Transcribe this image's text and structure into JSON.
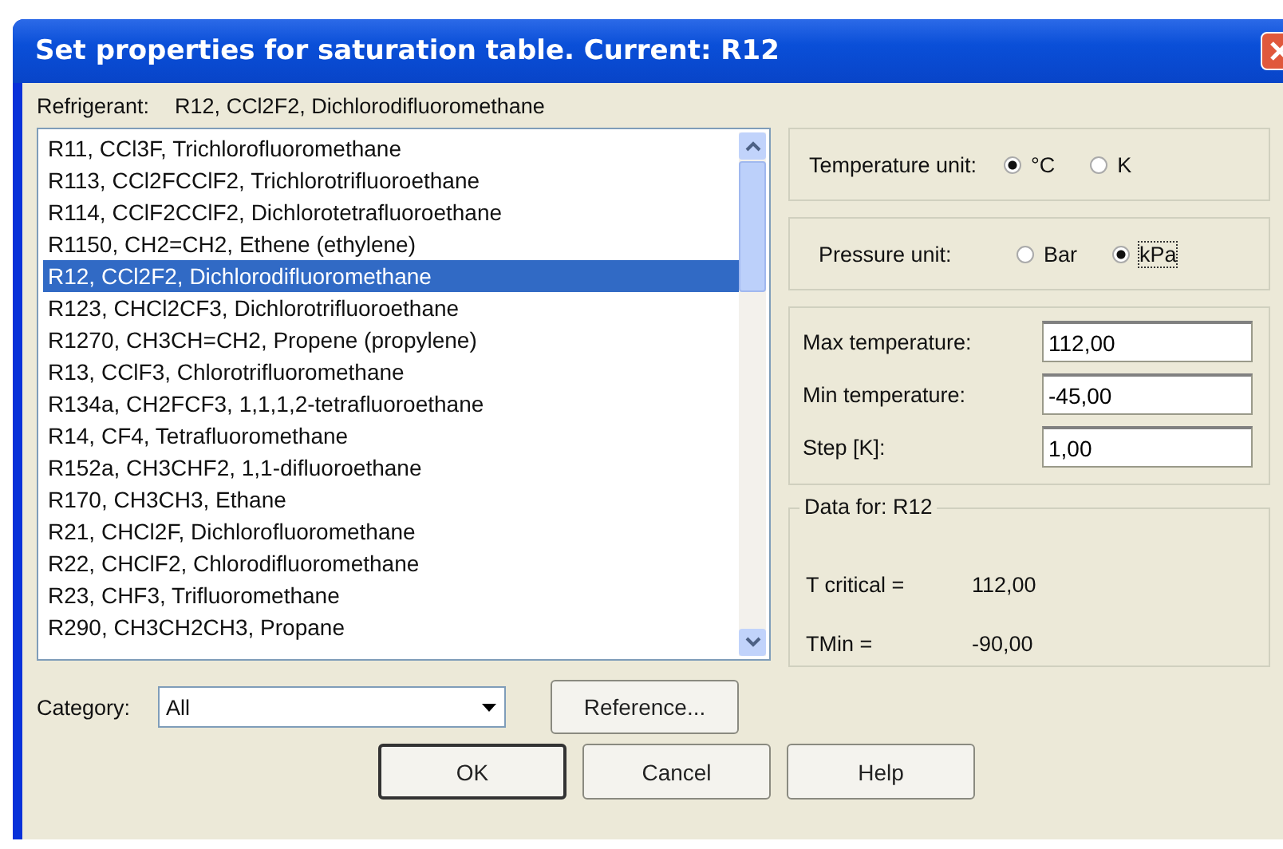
{
  "window": {
    "title": "Set properties for saturation table. Current: R12"
  },
  "refrigerant": {
    "label": "Refrigerant:",
    "value": "R12, CCl2F2, Dichlorodifluoromethane"
  },
  "list": {
    "items": [
      {
        "label": "R11, CCl3F, Trichlorofluoromethane",
        "selected": false
      },
      {
        "label": "R113, CCl2FCClF2, Trichlorotrifluoroethane",
        "selected": false
      },
      {
        "label": "R114, CClF2CClF2, Dichlorotetrafluoroethane",
        "selected": false
      },
      {
        "label": "R1150, CH2=CH2, Ethene (ethylene)",
        "selected": false
      },
      {
        "label": "R12, CCl2F2, Dichlorodifluoromethane",
        "selected": true
      },
      {
        "label": "R123, CHCl2CF3, Dichlorotrifluoroethane",
        "selected": false
      },
      {
        "label": "R1270, CH3CH=CH2, Propene (propylene)",
        "selected": false
      },
      {
        "label": "R13, CClF3, Chlorotrifluoromethane",
        "selected": false
      },
      {
        "label": "R134a, CH2FCF3, 1,1,1,2-tetrafluoroethane",
        "selected": false
      },
      {
        "label": "R14, CF4, Tetrafluoromethane",
        "selected": false
      },
      {
        "label": "R152a, CH3CHF2, 1,1-difluoroethane",
        "selected": false
      },
      {
        "label": "R170, CH3CH3, Ethane",
        "selected": false
      },
      {
        "label": "R21, CHCl2F, Dichlorofluoromethane",
        "selected": false
      },
      {
        "label": "R22, CHClF2, Chlorodifluoromethane",
        "selected": false
      },
      {
        "label": "R23, CHF3, Trifluoromethane",
        "selected": false
      },
      {
        "label": "R290, CH3CH2CH3, Propane",
        "selected": false
      }
    ]
  },
  "category": {
    "label": "Category:",
    "value": "All"
  },
  "reference_button": "Reference...",
  "temperature_unit": {
    "label": "Temperature unit:",
    "options": [
      {
        "label": "°C",
        "selected": true
      },
      {
        "label": "K",
        "selected": false
      }
    ]
  },
  "pressure_unit": {
    "label": "Pressure unit:",
    "options": [
      {
        "label": "Bar",
        "selected": false
      },
      {
        "label": "kPa",
        "selected": true
      }
    ]
  },
  "fields": [
    {
      "label": "Max temperature:",
      "value": "112,00"
    },
    {
      "label": "Min temperature:",
      "value": "-45,00"
    },
    {
      "label": "Step [K]:",
      "value": "1,00"
    }
  ],
  "data": {
    "title": "Data for: R12",
    "rows": [
      {
        "label": "T critical =",
        "value": "112,00"
      },
      {
        "label": "TMin =",
        "value": "-90,00"
      }
    ]
  },
  "buttons": [
    "OK",
    "Cancel",
    "Help"
  ]
}
